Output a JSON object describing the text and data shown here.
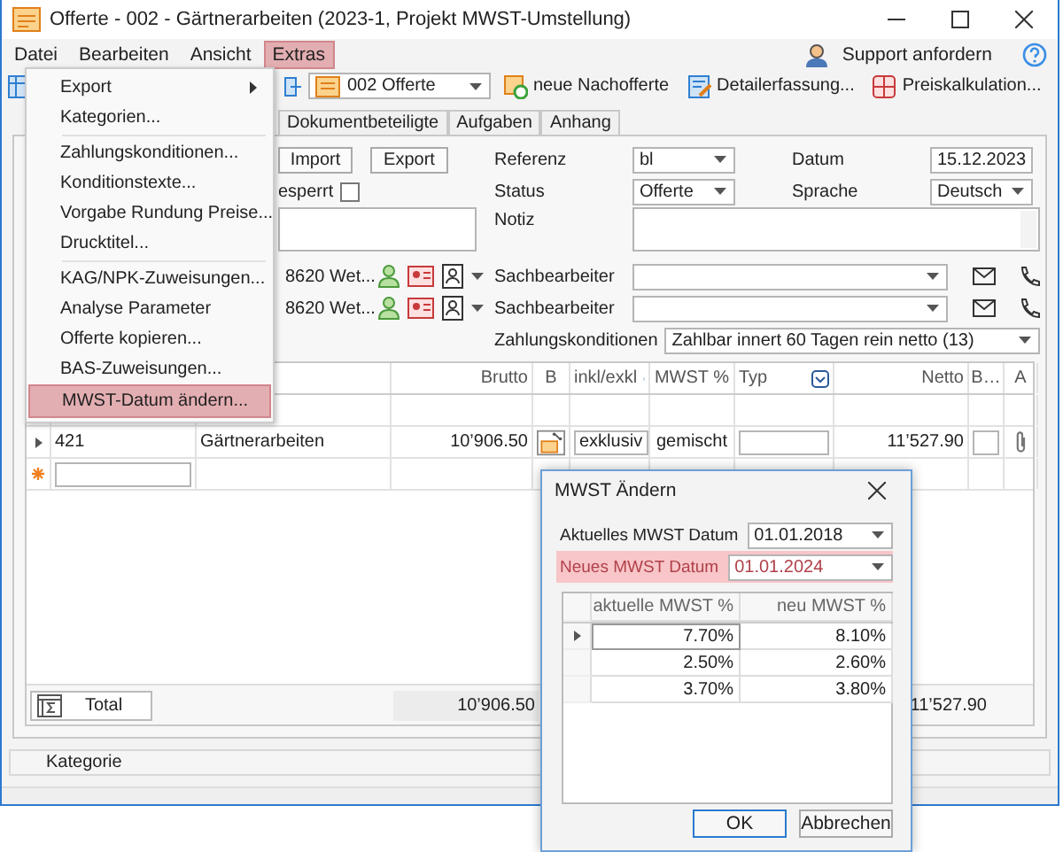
{
  "window": {
    "title": "Offerte - 002 - Gärtnerarbeiten (2023-1, Projekt MWST-Umstellung)"
  },
  "menu_bar": [
    {
      "label": "Datei",
      "selected": false
    },
    {
      "label": "Bearbeiten",
      "selected": false
    },
    {
      "label": "Ansicht",
      "selected": false
    },
    {
      "label": "Extras",
      "selected": true
    }
  ],
  "support": {
    "label": "Support anfordern"
  },
  "toolbar": {
    "document_combo": "002 Offerte",
    "buttons": [
      "neue Nachofferte",
      "Detailerfassung...",
      "Preiskalkulation..."
    ]
  },
  "tabs": [
    {
      "label": "Dokumentbeteiligte",
      "selected": false
    },
    {
      "label": "Aufgaben",
      "selected": false
    },
    {
      "label": "Anhang",
      "selected": false
    }
  ],
  "form_left": {
    "buttons": [
      "Import",
      "Export"
    ],
    "locked": {
      "label": "esperrt",
      "checked": false
    },
    "contacts": [
      "8620 Wet...",
      "8620 Wet..."
    ]
  },
  "form_right": {
    "referenz": {
      "label": "Referenz",
      "value": "bl"
    },
    "datum": {
      "label": "Datum",
      "value": "15.12.2023"
    },
    "status": {
      "label": "Status",
      "value": "Offerte"
    },
    "sprache": {
      "label": "Sprache",
      "value": "Deutsch"
    },
    "notiz": {
      "label": "Notiz"
    },
    "sachbearbeiter": [
      {
        "label": "Sachbearbeiter"
      },
      {
        "label": "Sachbearbeiter"
      }
    ],
    "zahlungskonditionen": {
      "label": "Zahlungskonditionen",
      "value": "Zahlbar innert 60 Tagen rein netto (13)"
    }
  },
  "grid": {
    "columns": [
      "Brutto",
      "B",
      "inkl/exkl",
      "MWST %",
      "Typ",
      "Netto",
      "B…",
      "A"
    ],
    "rows": [
      {
        "number": "421",
        "text": "Gärtnerarbeiten",
        "brutto": "10’906.50",
        "inkl_exkl": "exklusiv",
        "mwst": "gemischt",
        "netto": "11’527.90"
      }
    ],
    "total": {
      "label": "Total",
      "brutto": "10’906.50",
      "netto": "11’527.90"
    }
  },
  "category_bar": {
    "label": "Kategorie"
  },
  "extras_menu": {
    "groups": [
      [
        {
          "label": "Export",
          "submenu": true,
          "selected": false
        },
        {
          "label": "Kategorien...",
          "submenu": false,
          "selected": false
        }
      ],
      [
        {
          "label": "Zahlungskonditionen...",
          "submenu": false,
          "selected": false
        },
        {
          "label": "Konditionstexte...",
          "submenu": false,
          "selected": false
        },
        {
          "label": "Vorgabe Rundung Preise...",
          "submenu": false,
          "selected": false
        },
        {
          "label": "Drucktitel...",
          "submenu": false,
          "selected": false
        }
      ],
      [
        {
          "label": "KAG/NPK-Zuweisungen...",
          "submenu": false,
          "selected": false
        },
        {
          "label": "Analyse Parameter",
          "submenu": false,
          "selected": false
        },
        {
          "label": "Offerte kopieren...",
          "submenu": false,
          "selected": false
        },
        {
          "label": "BAS-Zuweisungen...",
          "submenu": false,
          "selected": false
        },
        {
          "label": "MWST-Datum ändern...",
          "submenu": false,
          "selected": true
        }
      ]
    ]
  },
  "dialog": {
    "title": "MWST Ändern",
    "fields": [
      {
        "label": "Aktuelles MWST Datum",
        "value": "01.01.2018",
        "highlighted": false
      },
      {
        "label": "Neues MWST Datum",
        "value": "01.01.2024",
        "highlighted": true
      }
    ],
    "table": {
      "columns": [
        "aktuelle MWST %",
        "neu MWST %"
      ],
      "rows": [
        {
          "current": "7.70%",
          "new": "8.10%",
          "selected": true
        },
        {
          "current": "2.50%",
          "new": "2.60%",
          "selected": false
        },
        {
          "current": "3.70%",
          "new": "3.80%",
          "selected": false
        }
      ]
    },
    "buttons": [
      {
        "label": "OK",
        "default": true
      },
      {
        "label": "Abbrechen",
        "default": false
      }
    ]
  }
}
